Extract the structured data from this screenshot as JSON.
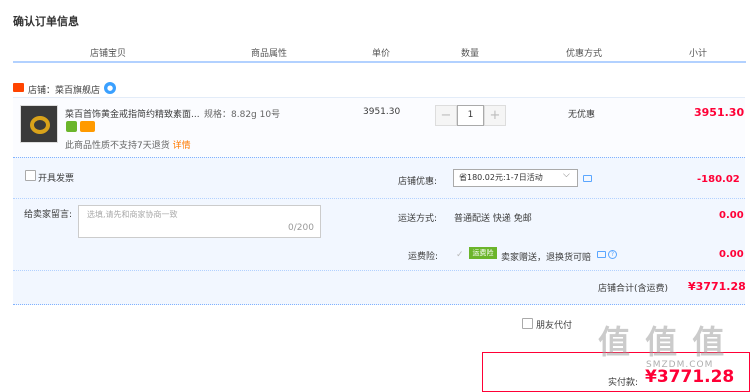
{
  "page_title": "确认订单信息",
  "columns": [
    "店铺宝贝",
    "商品属性",
    "单价",
    "数量",
    "优惠方式",
    "小计"
  ],
  "shop": {
    "label": "店铺：菜百旗舰店"
  },
  "item": {
    "name": "菜百首饰黄金戒指简约精致素面...",
    "spec": "规格：8.82g 10号",
    "return_note": "此商品性质不支持7天退货",
    "return_link": "详情",
    "unit_price": "3951.30",
    "quantity": "1",
    "minus": "−",
    "plus": "+",
    "discount": "无优惠",
    "subtotal": "3951.30"
  },
  "options": {
    "invoice_label": "开具发票",
    "shop_coupon_label": "店铺优惠:",
    "shop_coupon_value": "省180.02元:1-7日活动",
    "shop_coupon_amount": "-180.02",
    "message_label": "给卖家留言:",
    "message_placeholder": "选填,请先和商家协商一致",
    "message_count": "0/200",
    "shipping_label": "运送方式:",
    "shipping_value": "普通配送 快递 免邮",
    "shipping_amount": "0.00",
    "insurance_label": "运费险:",
    "insurance_tag": "运费险",
    "insurance_value": "卖家赠送，退换货可赔",
    "insurance_amount": "0.00",
    "shop_total_label": "店铺合计(含运费)",
    "shop_total_value": "¥3771.28"
  },
  "friend_pay_label": "朋友代付",
  "pay": {
    "label": "实付款:",
    "value": "¥3771.28"
  },
  "watermark": {
    "text": "值 值 值",
    "sub": "SMZDM.COM"
  },
  "colors": {
    "accent_red": "#ff0036",
    "border_blue": "#b2d1ff",
    "option_bg": "#f2f7ff"
  }
}
